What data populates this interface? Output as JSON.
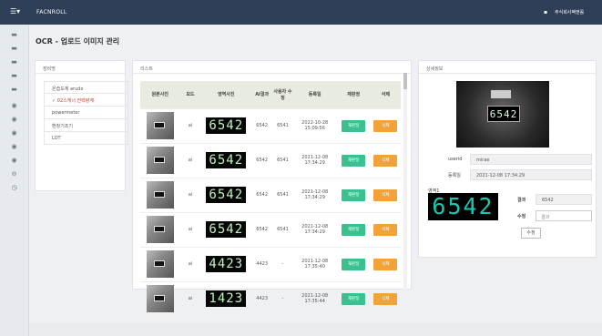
{
  "topbar": {
    "menu_icon": "☰▾",
    "brand": "FACNROLL",
    "dot": "▪",
    "company": "주식회사팩앤롤"
  },
  "page": {
    "title": "OCR - 업로드 이미지 관리"
  },
  "category": {
    "header": "장비명",
    "items": [
      {
        "label": "온습도계 arudo",
        "active": false
      },
      {
        "label": "✓ 02스캐너 전력량계",
        "active": true
      },
      {
        "label": "powermeter",
        "active": false
      },
      {
        "label": "환창기조기",
        "active": false
      },
      {
        "label": "LOT",
        "active": false
      }
    ]
  },
  "list": {
    "header": "리스트",
    "columns": [
      "원본사진",
      "모드",
      "영역사진",
      "AI결과",
      "사용자 수정",
      "등록일",
      "재판정",
      "삭제"
    ],
    "rows": [
      {
        "mode": "ai",
        "plate": "6542",
        "ai": "6542",
        "user": "6541",
        "date": "2022-10-28 15:09:56",
        "rejudge": "재판정",
        "delete": "삭제"
      },
      {
        "mode": "ai",
        "plate": "6542",
        "ai": "6542",
        "user": "6541",
        "date": "2021-12-08 17:34:29",
        "rejudge": "재판정",
        "delete": "삭제"
      },
      {
        "mode": "ai",
        "plate": "6542",
        "ai": "6542",
        "user": "6541",
        "date": "2021-12-08 17:34:29",
        "rejudge": "재판정",
        "delete": "삭제"
      },
      {
        "mode": "ai",
        "plate": "6542",
        "ai": "6542",
        "user": "6541",
        "date": "2021-12-08 17:34:29",
        "rejudge": "재판정",
        "delete": "삭제"
      },
      {
        "mode": "ai",
        "plate": "4423",
        "ai": "4423",
        "user": "-",
        "date": "2021-12-08 17:35:40",
        "rejudge": "재판정",
        "delete": "삭제"
      },
      {
        "mode": "ai",
        "plate": "1423",
        "ai": "4423",
        "user": "-",
        "date": "2021-12-08 17:35:44",
        "rejudge": "재판정",
        "delete": "삭제"
      }
    ]
  },
  "detail": {
    "header": "상세정보",
    "image_plate": "6542",
    "userid_label": "userid",
    "userid_value": "mirae",
    "registered_label": "등록일",
    "registered_value": "2021-12-08 17:34:29",
    "area_label": "영역1",
    "area_plate": "6542",
    "result_label": "결과",
    "result_value": "6542",
    "edit_label": "수정",
    "edit_placeholder": "결과",
    "edit_button": "수정"
  },
  "colors": {
    "topbar": "#2f3f57",
    "green": "#3cc08f",
    "orange": "#f1a33a"
  }
}
